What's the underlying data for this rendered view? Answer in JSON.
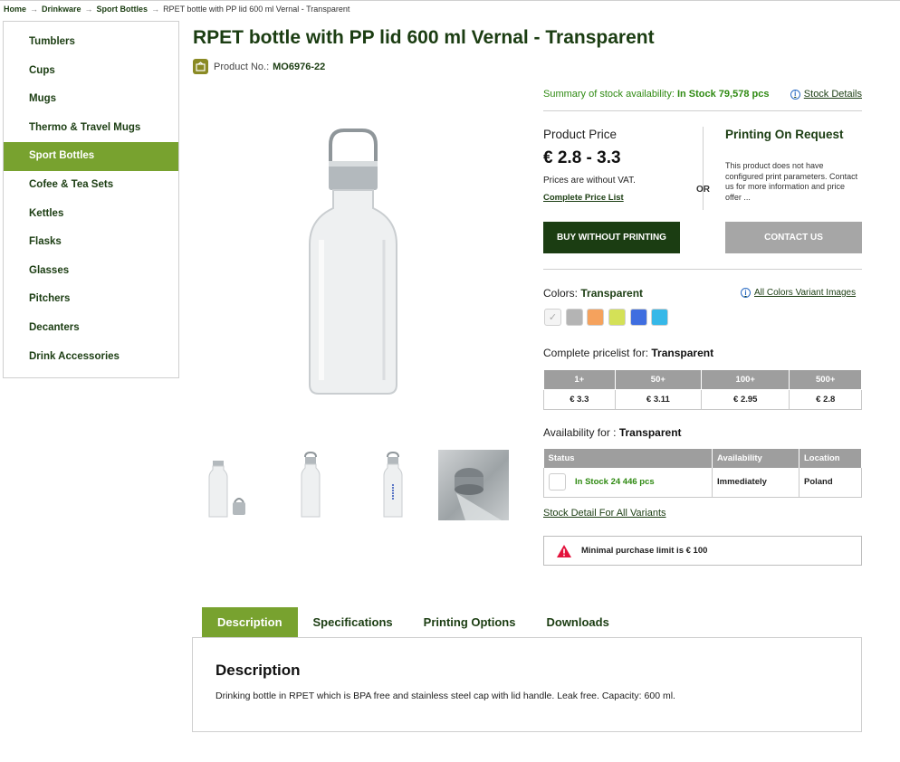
{
  "breadcrumb": {
    "items": [
      "Home",
      "Drinkware",
      "Sport Bottles"
    ],
    "current": "RPET bottle with PP lid 600 ml Vernal - Transparent",
    "separator": "→"
  },
  "sidebar": {
    "items": [
      {
        "label": "Tumblers"
      },
      {
        "label": "Cups"
      },
      {
        "label": "Mugs"
      },
      {
        "label": "Thermo & Travel Mugs"
      },
      {
        "label": "Sport Bottles",
        "active": true
      },
      {
        "label": "Cofee & Tea Sets"
      },
      {
        "label": "Kettles"
      },
      {
        "label": "Flasks"
      },
      {
        "label": "Glasses"
      },
      {
        "label": "Pitchers"
      },
      {
        "label": "Decanters"
      },
      {
        "label": "Drink Accessories"
      }
    ],
    "accent_color": "#78a22f"
  },
  "product": {
    "title": "RPET bottle with PP lid 600 ml Vernal - Transparent",
    "number_label": "Product No.:",
    "number": "MO6976-22"
  },
  "stock": {
    "summary_label": "Summary of stock availability:",
    "summary_value": "In Stock 79,578 pcs",
    "details_link": "Stock Details"
  },
  "pricing": {
    "label": "Product Price",
    "value": "€ 2.8 - 3.3",
    "vat_note": "Prices are without VAT.",
    "price_list_link": "Complete Price List",
    "or_label": "OR",
    "por_title": "Printing On Request",
    "por_text": "This product does not have configured print parameters. Contact us for more information and price offer ...",
    "buy_button": "BUY WITHOUT PRINTING",
    "contact_button": "CONTACT US"
  },
  "colors": {
    "label": "Colors:",
    "selected": "Transparent",
    "variant_link": "All Colors Variant Images",
    "swatches": [
      {
        "name": "transparent",
        "hex": "#f4f4f4"
      },
      {
        "name": "grey",
        "hex": "#b4b4b4"
      },
      {
        "name": "orange",
        "hex": "#f5a25d"
      },
      {
        "name": "lime",
        "hex": "#d4e157"
      },
      {
        "name": "blue",
        "hex": "#3f6ee0"
      },
      {
        "name": "cyan",
        "hex": "#36b8e8"
      }
    ]
  },
  "pricelist": {
    "label": "Complete pricelist for:",
    "variant": "Transparent",
    "headers": [
      "1+",
      "50+",
      "100+",
      "500+"
    ],
    "values": [
      "€ 3.3",
      "€ 3.11",
      "€ 2.95",
      "€ 2.8"
    ]
  },
  "availability": {
    "label": "Availability for :",
    "variant": "Transparent",
    "headers": [
      "Status",
      "Availability",
      "Location"
    ],
    "row": {
      "status": "In Stock 24 446 pcs",
      "availability": "Immediately",
      "location": "Poland"
    },
    "detail_link": "Stock Detail For All Variants",
    "limit_text": "Minimal purchase limit is € 100"
  },
  "tabs": [
    {
      "label": "Description",
      "active": true
    },
    {
      "label": "Specifications"
    },
    {
      "label": "Printing Options"
    },
    {
      "label": "Downloads"
    }
  ],
  "description": {
    "title": "Description",
    "text": "Drinking bottle in RPET which is BPA free and stainless steel cap with lid handle. Leak free. Capacity: 600 ml."
  },
  "theme": {
    "dark_green": "#1b3d12",
    "accent_green": "#78a22f",
    "stock_green": "#2f8a12",
    "grey_button": "#a6a6a6"
  }
}
